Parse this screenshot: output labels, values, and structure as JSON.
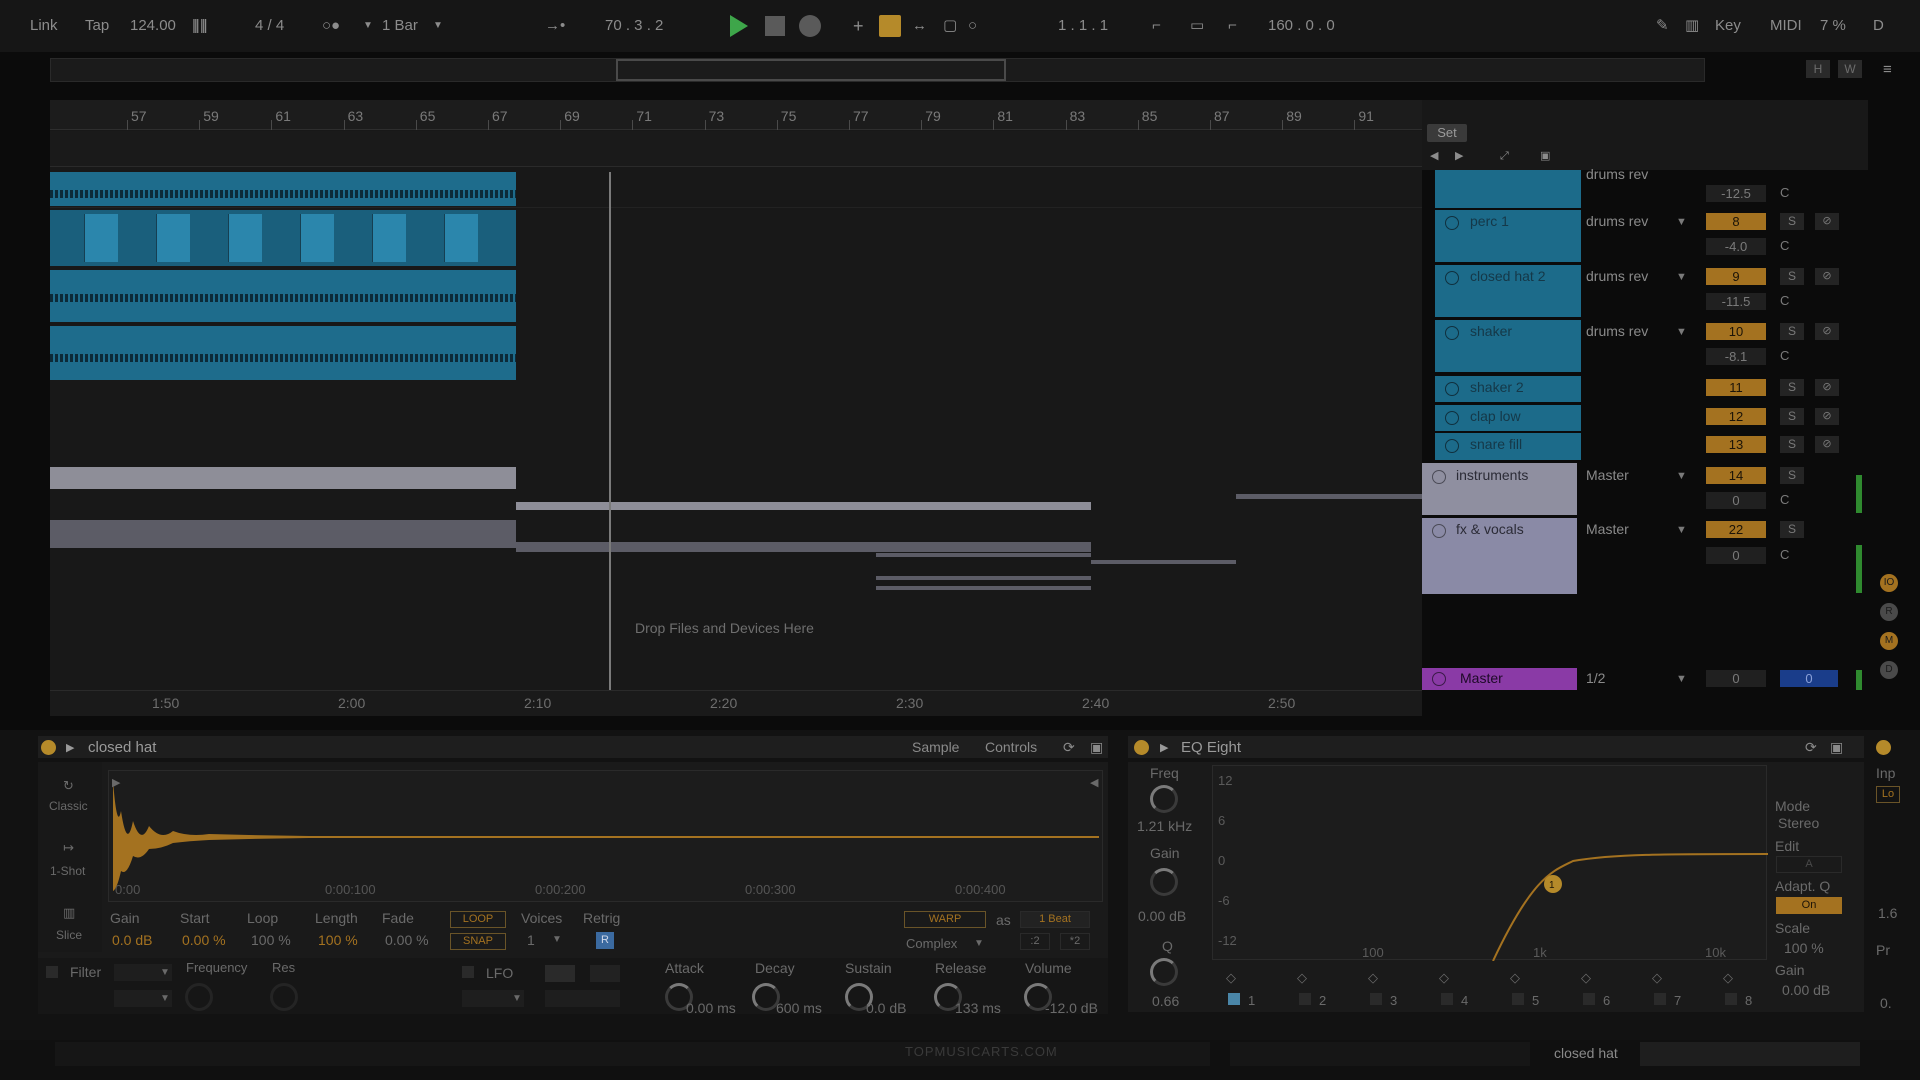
{
  "transport": {
    "link": "Link",
    "tap": "Tap",
    "tempo": "124.00",
    "time_sig": "4 / 4",
    "quantize": "1 Bar",
    "position": "70 .  3 .  2",
    "loop_start": "1 .  1 .  1",
    "loop_length": "160 .  0 .  0",
    "key": "Key",
    "midi": "MIDI",
    "cpu": "7 %",
    "disk": "D"
  },
  "overview": {
    "h": "H",
    "w": "W"
  },
  "ruler": {
    "bars": [
      "57",
      "59",
      "61",
      "63",
      "65",
      "67",
      "69",
      "71",
      "73",
      "75",
      "77",
      "79",
      "81",
      "83",
      "85",
      "87",
      "89",
      "91"
    ]
  },
  "timeline": {
    "times": [
      "1:50",
      "2:00",
      "2:10",
      "2:20",
      "2:30",
      "2:40",
      "2:50"
    ]
  },
  "arrangement": {
    "drop_text": "Drop Files and Devices Here"
  },
  "mixer": {
    "set": "Set",
    "top_route": "drums rev",
    "top_vol": "-12.5",
    "tracks": [
      {
        "name": "perc 1",
        "route": "drums rev",
        "num": "8",
        "vol": "-4.0",
        "pan": "C"
      },
      {
        "name": "closed hat 2",
        "route": "drums rev",
        "num": "9",
        "vol": "-11.5",
        "pan": "C"
      },
      {
        "name": "shaker",
        "route": "drums rev",
        "num": "10",
        "vol": "-8.1",
        "pan": "C"
      },
      {
        "name": "shaker 2",
        "num": "11"
      },
      {
        "name": "clap low",
        "num": "12"
      },
      {
        "name": "snare fill",
        "num": "13"
      }
    ],
    "groups": [
      {
        "name": "instruments",
        "route": "Master",
        "num": "14",
        "vol": "0",
        "pan": "C"
      },
      {
        "name": "fx & vocals",
        "route": "Master",
        "num": "22",
        "vol": "0",
        "pan": "C"
      }
    ],
    "master": {
      "name": "Master",
      "route": "1/2",
      "vol": "0",
      "pan": "0"
    },
    "solo": "S",
    "pan_c": "C"
  },
  "side_buttons": [
    "IO",
    "R",
    "M",
    "D"
  ],
  "simpler": {
    "title": "closed hat",
    "tab_sample": "Sample",
    "tab_controls": "Controls",
    "modes": [
      "Classic",
      "1-Shot",
      "Slice"
    ],
    "time_labels": [
      "0:00",
      "0:00:100",
      "0:00:200",
      "0:00:300",
      "0:00:400"
    ],
    "params": {
      "gain_label": "Gain",
      "gain": "0.0 dB",
      "start_label": "Start",
      "start": "0.00 %",
      "loop_label": "Loop",
      "loop": "100 %",
      "length_label": "Length",
      "length": "100 %",
      "fade_label": "Fade",
      "fade": "0.00 %",
      "loop_btn": "LOOP",
      "snap_btn": "SNAP",
      "voices_label": "Voices",
      "voices": "1",
      "retrig_label": "Retrig",
      "retrig": "R",
      "warp_btn": "WARP",
      "as": "as",
      "beat": "1 Beat",
      "complex": "Complex",
      "half": ":2",
      "double": "*2",
      "filter": "Filter",
      "frequency": "Frequency",
      "res": "Res",
      "lfo": "LFO",
      "attack_label": "Attack",
      "attack": "0.00 ms",
      "decay_label": "Decay",
      "decay": "600 ms",
      "sustain_label": "Sustain",
      "sustain": "0.0 dB",
      "release_label": "Release",
      "release": "133 ms",
      "volume_label": "Volume",
      "volume": "-12.0 dB"
    }
  },
  "eq": {
    "title": "EQ Eight",
    "freq_label": "Freq",
    "freq": "1.21 kHz",
    "gain_label": "Gain",
    "gain": "0.00 dB",
    "q_label": "Q",
    "q": "0.66",
    "y_axis": [
      "12",
      "6",
      "0",
      "-6",
      "-12"
    ],
    "x_axis": [
      "100",
      "1k",
      "10k"
    ],
    "bands": [
      "1",
      "2",
      "3",
      "4",
      "5",
      "6",
      "7",
      "8"
    ],
    "band_marker": "1",
    "mode_label": "Mode",
    "mode": "Stereo",
    "edit_label": "Edit",
    "edit_val": "A",
    "adapt_label": "Adapt. Q",
    "adapt": "On",
    "scale_label": "Scale",
    "scale": "100 %",
    "out_gain_label": "Gain",
    "out_gain": "0.00 dB",
    "colors": {
      "accent": "#a47220"
    }
  },
  "third_device": {
    "inp": "Inp",
    "lo": "Lo",
    "val1": "1.6",
    "pr": "Pr",
    "val2": "0."
  },
  "status": {
    "selected": "closed hat",
    "watermark": "TOPMUSICARTS.COM"
  }
}
